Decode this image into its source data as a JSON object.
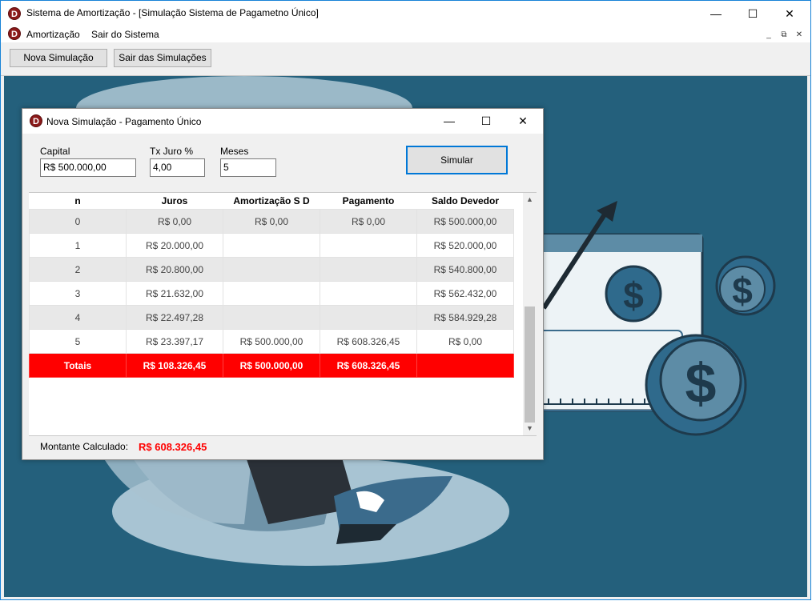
{
  "app": {
    "title": "Sistema de Amortização - [Simulação Sistema de Pagametno Único]",
    "icon_letter": "D",
    "menu": [
      "Amortização",
      "Sair do Sistema"
    ],
    "toolbar": {
      "nova": "Nova Simulação",
      "sair": "Sair das Simulações"
    }
  },
  "child": {
    "title": "Nova Simulação - Pagamento Único",
    "capital_label": "Capital",
    "capital_value": "R$ 500.000,00",
    "juro_label": "Tx Juro %",
    "juro_value": "4,00",
    "meses_label": "Meses",
    "meses_value": "5",
    "simular_label": "Simular",
    "columns": [
      "n",
      "Juros",
      "Amortização S D",
      "Pagamento",
      "Saldo Devedor"
    ],
    "rows": [
      [
        "0",
        "R$ 0,00",
        "R$ 0,00",
        "R$ 0,00",
        "R$ 500.000,00"
      ],
      [
        "1",
        "R$ 20.000,00",
        "",
        "",
        "R$ 520.000,00"
      ],
      [
        "2",
        "R$ 20.800,00",
        "",
        "",
        "R$ 540.800,00"
      ],
      [
        "3",
        "R$ 21.632,00",
        "",
        "",
        "R$ 562.432,00"
      ],
      [
        "4",
        "R$ 22.497,28",
        "",
        "",
        "R$ 584.929,28"
      ],
      [
        "5",
        "R$ 23.397,17",
        "R$ 500.000,00",
        "R$ 608.326,45",
        "R$ 0,00"
      ]
    ],
    "totals": [
      "Totais",
      "R$ 108.326,45",
      "R$ 500.000,00",
      "R$ 608.326,45",
      ""
    ],
    "montante_label": "Montante Calculado:",
    "montante_value": "R$ 608.326,45"
  },
  "colors": {
    "desktop_bg": "#24607c",
    "totals_row": "#ff0000",
    "accent": "#0078d7"
  }
}
